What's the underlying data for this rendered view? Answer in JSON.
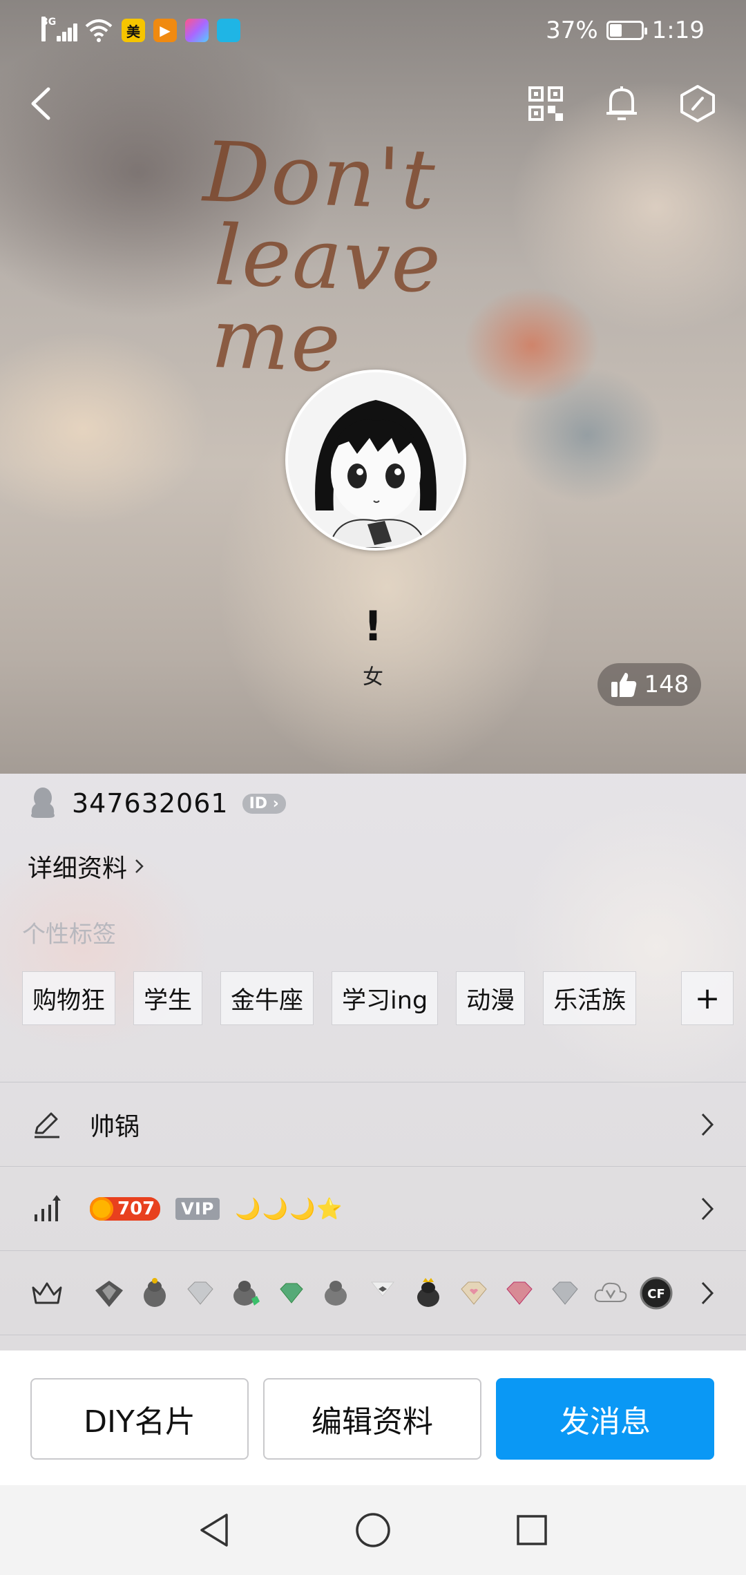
{
  "status_bar": {
    "network": "3G",
    "app_icons": [
      {
        "label": "美",
        "color": "#f6c500"
      },
      {
        "label": "▶",
        "color": "#f08a10"
      },
      {
        "label": "",
        "color": "#e35cd0"
      },
      {
        "label": "",
        "color": "#1fb5e5"
      }
    ],
    "battery": "37%",
    "battery_level": 0.37,
    "time": "1:19"
  },
  "background_text": [
    "Don't",
    "leave me"
  ],
  "profile": {
    "nickname": "!",
    "gender": "女",
    "likes": "148",
    "qq_number": "347632061",
    "id_badge": "ID",
    "detail_link": "详细资料"
  },
  "tags": {
    "title": "个性标签",
    "items": [
      "购物狂",
      "学生",
      "金牛座",
      "学习ing",
      "动漫",
      "乐活族"
    ],
    "add_label": "+"
  },
  "rows": {
    "signature": "帅锅",
    "level": {
      "coin": "707",
      "vip": "VIP",
      "moons": "🌙🌙🌙⭐"
    },
    "badges": [
      "penguin-badge",
      "diamond-badge",
      "gem-badge",
      "cloud-v-badge",
      "cf-badge"
    ]
  },
  "actions": {
    "diy": "DIY名片",
    "edit": "编辑资料",
    "message": "发消息"
  },
  "colors": {
    "primary": "#0a98f5",
    "like_pill": "#5a5552"
  }
}
